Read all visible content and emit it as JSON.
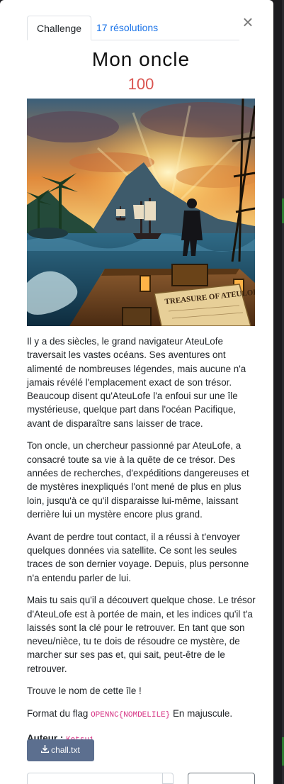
{
  "tabs": {
    "challenge": "Challenge",
    "solves": "17 résolutions"
  },
  "close_glyph": "×",
  "challenge": {
    "title": "Mon oncle",
    "points": "100",
    "image_caption": "TREASURE OF ATEULOFE",
    "paragraphs": [
      "Il y a des siècles, le grand navigateur AteuLofe traversait les vastes océans. Ses aventures ont alimenté de nombreuses légendes, mais aucune n'a jamais révélé l'emplacement exact de son trésor. Beaucoup disent qu'AteuLofe l'a enfoui sur une île mystérieuse, quelque part dans l'océan Pacifique, avant de disparaître sans laisser de trace.",
      "Ton oncle, un chercheur passionné par AteuLofe, a consacré toute sa vie à la quête de ce trésor. Des années de recherches, d'expéditions dangereuses et de mystères inexpliqués l'ont mené de plus en plus loin, jusqu'à ce qu'il disparaisse lui-même, laissant derrière lui un mystère encore plus grand.",
      "Avant de perdre tout contact, il a réussi à t'envoyer quelques données via satellite. Ce sont les seules traces de son dernier voyage. Depuis, plus personne n'a entendu parler de lui.",
      "Mais tu sais qu'il a découvert quelque chose. Le trésor d'AteuLofe est à portée de main, et les indices qu'il t'a laissés sont la clé pour le retrouver. En tant que son neveu/nièce, tu te dois de résoudre ce mystère, de marcher sur ses pas et, qui sait, peut-être de le retrouver.",
      "Trouve le nom de cette île !"
    ],
    "format_prefix": "Format du flag ",
    "format_code": "OPENNC{NOMDELILE}",
    "format_suffix": " En majuscule.",
    "author_label": "Auteur :",
    "author_name": "Ketsui",
    "download_label": "chall.txt"
  },
  "colors": {
    "points": "#d9534f",
    "link": "#1a73e8",
    "download_bg": "#5c6f8f",
    "code": "#d63384"
  }
}
